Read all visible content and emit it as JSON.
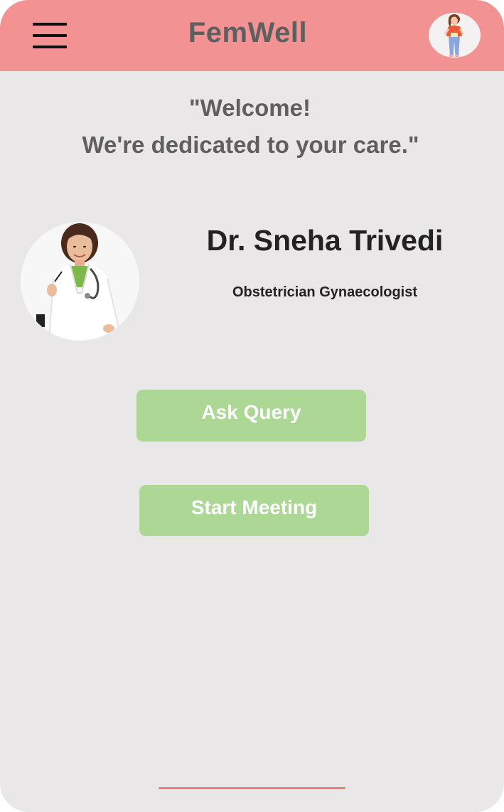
{
  "header": {
    "app_title": "FemWell",
    "menu_icon": "hamburger-menu-icon",
    "profile_icon": "user-avatar"
  },
  "welcome": {
    "line1": "\"Welcome!",
    "line2": "We're dedicated to your care.\""
  },
  "doctor": {
    "name": "Dr. Sneha Trivedi",
    "specialty": "Obstetrician Gynaecologist"
  },
  "actions": {
    "ask_query_label": "Ask Query",
    "start_meeting_label": "Start Meeting"
  },
  "colors": {
    "header_bg": "#f29292",
    "page_bg": "#eae7e8",
    "button_bg": "#acd795",
    "title_text": "#5f5f5f",
    "home_indicator": "#ee7a7a"
  }
}
